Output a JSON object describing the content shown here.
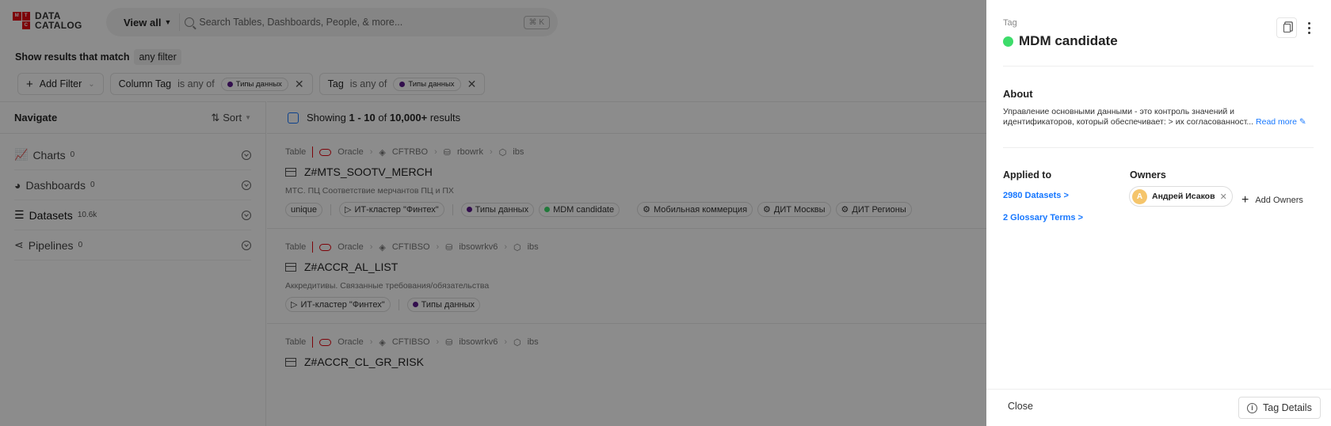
{
  "app": {
    "logo_letters": [
      "M",
      "T",
      "",
      "C"
    ],
    "logo_line1": "DATA",
    "logo_line2": "CATALOG"
  },
  "search": {
    "scope": "View all",
    "placeholder": "Search Tables, Dashboards, People, & more...",
    "shortcut": "⌘ K"
  },
  "filter_bar": {
    "label": "Show results that match",
    "match_mode": "any filter",
    "add_filter": "Add Filter",
    "filters": [
      {
        "field": "Column Tag",
        "operator": "is any of",
        "value": "Типы данных",
        "dot_color": "#5b1a8c"
      },
      {
        "field": "Tag",
        "operator": "is any of",
        "value": "Типы данных",
        "dot_color": "#5b1a8c"
      }
    ]
  },
  "navigate": {
    "title": "Navigate",
    "sort_label": "Sort",
    "items": [
      {
        "label": "Charts",
        "count": "0"
      },
      {
        "label": "Dashboards",
        "count": "0"
      },
      {
        "label": "Datasets",
        "count": "10.6k"
      },
      {
        "label": "Pipelines",
        "count": "0"
      }
    ]
  },
  "results": {
    "showing_prefix": "Showing",
    "range": "1 - 10",
    "of": "of",
    "total": "10,000+",
    "suffix": "results",
    "items": [
      {
        "type": "Table",
        "platform": "Oracle",
        "db": "CFTRBO",
        "schema": "rbowrk",
        "container": "ibs",
        "name": "Z#MTS_SOOTV_MERCH",
        "description": "МТС. ПЦ Соответствие мерчантов ПЦ и ПХ",
        "tags": [
          "unique",
          "ИТ-кластер \"Финтех\"",
          "Типы данных",
          "MDM candidate",
          "Мобильная коммерция",
          "ДИТ Москвы",
          "ДИТ Регионы"
        ]
      },
      {
        "type": "Table",
        "platform": "Oracle",
        "db": "CFTIBSO",
        "schema": "ibsowrkv6",
        "container": "ibs",
        "name": "Z#ACCR_AL_LIST",
        "description": "Аккредитивы. Связанные требования/обязательства",
        "tags": [
          "ИТ-кластер \"Финтех\"",
          "Типы данных"
        ]
      },
      {
        "type": "Table",
        "platform": "Oracle",
        "db": "CFTIBSO",
        "schema": "ibsowrkv6",
        "container": "ibs",
        "name": "Z#ACCR_CL_GR_RISK"
      }
    ]
  },
  "drawer": {
    "entity_type": "Tag",
    "title": "MDM candidate",
    "tag_color": "#3ddc6a",
    "about_title": "About",
    "about_text_1": "Управление основными данными - это контроль значений и",
    "about_text_2": "идентификаторов, который обеспечивает: > их согласованност...",
    "read_more": "Read more",
    "applied_title": "Applied to",
    "applied_datasets": "2980 Datasets >",
    "applied_glossary": "2 Glossary Terms >",
    "owners_title": "Owners",
    "owner_initial": "А",
    "owner_name": "Андрей Исаков",
    "add_owners": "Add Owners",
    "close": "Close",
    "tag_details": "Tag Details"
  }
}
